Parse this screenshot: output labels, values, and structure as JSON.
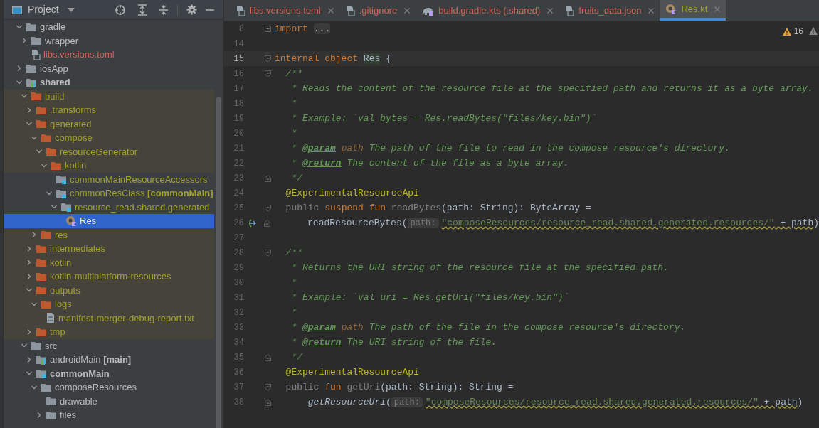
{
  "project_panel": {
    "title": "Project",
    "tree": [
      {
        "label": "gradle",
        "kind": "folder",
        "untracked": false,
        "excluded": false,
        "generated": false,
        "selected": false,
        "expanded": true,
        "children": [
          {
            "label": "wrapper",
            "kind": "folder",
            "untracked": false,
            "excluded": false,
            "generated": false,
            "selected": false,
            "expanded": false
          },
          {
            "label": "libs.versions.toml",
            "kind": "toml",
            "untracked": true,
            "excluded": false,
            "generated": false,
            "selected": false
          }
        ]
      },
      {
        "label": "iosApp",
        "kind": "folder",
        "untracked": false,
        "excluded": false,
        "generated": false,
        "selected": false,
        "expanded": false
      },
      {
        "label": "shared",
        "kind": "module",
        "untracked": false,
        "excluded": false,
        "generated": false,
        "selected": false,
        "bold": true,
        "expanded": true,
        "children": [
          {
            "label": "build",
            "kind": "folder",
            "untracked": false,
            "excluded": true,
            "generated": true,
            "selected": false,
            "expanded": true,
            "children": [
              {
                "label": ".transforms",
                "kind": "folder",
                "untracked": false,
                "excluded": true,
                "generated": true,
                "selected": false,
                "expanded": false
              },
              {
                "label": "generated",
                "kind": "folder",
                "untracked": false,
                "excluded": true,
                "generated": true,
                "selected": false,
                "expanded": true,
                "children": [
                  {
                    "label": "compose",
                    "kind": "folder",
                    "untracked": false,
                    "excluded": true,
                    "generated": true,
                    "selected": false,
                    "expanded": true,
                    "children": [
                      {
                        "label": "resourceGenerator",
                        "kind": "folder",
                        "untracked": false,
                        "excluded": true,
                        "generated": true,
                        "selected": false,
                        "expanded": true,
                        "children": [
                          {
                            "label": "kotlin",
                            "kind": "folder",
                            "untracked": false,
                            "excluded": true,
                            "generated": true,
                            "selected": false,
                            "expanded": true,
                            "children": [
                              {
                                "label": "commonMainResourceAccessors",
                                "kind": "source-folder",
                                "untracked": false,
                                "excluded": false,
                                "generated": true,
                                "selected": false
                              },
                              {
                                "label": "commonResClass **[commonMain]**",
                                "kind": "source-folder",
                                "untracked": false,
                                "excluded": false,
                                "generated": true,
                                "selected": false,
                                "expanded": true,
                                "children": [
                                  {
                                    "label": "resource_read.shared.generated",
                                    "kind": "package",
                                    "untracked": false,
                                    "excluded": false,
                                    "generated": true,
                                    "selected": false,
                                    "expanded": true,
                                    "children": [
                                      {
                                        "label": "Res",
                                        "kind": "kotlin-object",
                                        "untracked": false,
                                        "excluded": false,
                                        "generated": true,
                                        "selected": true
                                      }
                                    ]
                                  }
                                ]
                              }
                            ]
                          }
                        ]
                      }
                    ]
                  },
                  {
                    "label": "res",
                    "kind": "folder",
                    "untracked": false,
                    "excluded": true,
                    "generated": true,
                    "selected": false,
                    "expanded": false
                  }
                ]
              },
              {
                "label": "intermediates",
                "kind": "folder",
                "untracked": false,
                "excluded": true,
                "generated": true,
                "selected": false,
                "expanded": false
              },
              {
                "label": "kotlin",
                "kind": "folder",
                "untracked": false,
                "excluded": true,
                "generated": true,
                "selected": false,
                "expanded": false
              },
              {
                "label": "kotlin-multiplatform-resources",
                "kind": "folder",
                "untracked": false,
                "excluded": true,
                "generated": true,
                "selected": false,
                "expanded": false
              },
              {
                "label": "outputs",
                "kind": "folder",
                "untracked": false,
                "excluded": true,
                "generated": true,
                "selected": false,
                "expanded": true,
                "children": [
                  {
                    "label": "logs",
                    "kind": "folder",
                    "untracked": false,
                    "excluded": true,
                    "generated": true,
                    "selected": false,
                    "expanded": true,
                    "children": [
                      {
                        "label": "manifest-merger-debug-report.txt",
                        "kind": "text-file",
                        "untracked": false,
                        "excluded": true,
                        "generated": true,
                        "selected": false
                      }
                    ]
                  }
                ]
              },
              {
                "label": "tmp",
                "kind": "folder",
                "untracked": false,
                "excluded": true,
                "generated": true,
                "selected": false,
                "expanded": false
              }
            ]
          },
          {
            "label": "src",
            "kind": "folder",
            "untracked": false,
            "excluded": false,
            "generated": false,
            "selected": false,
            "expanded": true,
            "children": [
              {
                "label": "androidMain **[main]**",
                "kind": "module",
                "untracked": false,
                "excluded": false,
                "generated": false,
                "selected": false,
                "expanded": false
              },
              {
                "label": "commonMain",
                "kind": "source-folder",
                "untracked": false,
                "excluded": false,
                "generated": false,
                "selected": false,
                "bold": true,
                "expanded": true,
                "children": [
                  {
                    "label": "composeResources",
                    "kind": "folder",
                    "untracked": false,
                    "excluded": false,
                    "generated": false,
                    "selected": false,
                    "expanded": true,
                    "children": [
                      {
                        "label": "drawable",
                        "kind": "folder",
                        "untracked": false,
                        "excluded": false,
                        "generated": false,
                        "selected": false
                      },
                      {
                        "label": "files",
                        "kind": "folder",
                        "untracked": false,
                        "excluded": false,
                        "generated": false,
                        "selected": false,
                        "expanded": false
                      }
                    ]
                  }
                ]
              }
            ]
          }
        ]
      }
    ]
  },
  "editor": {
    "tabs": [
      {
        "label": "libs.versions.toml",
        "kind": "toml",
        "untracked": true,
        "generated": false,
        "selected": false
      },
      {
        "label": ".gitignore",
        "kind": "ignore",
        "untracked": true,
        "generated": false,
        "selected": false
      },
      {
        "label": "build.gradle.kts (:shared)",
        "kind": "gradle",
        "untracked": true,
        "generated": false,
        "selected": false
      },
      {
        "label": "fruits_data.json",
        "kind": "json",
        "untracked": true,
        "generated": false,
        "selected": false
      },
      {
        "label": "Res.kt",
        "kind": "kotlin-object",
        "untracked": false,
        "generated": true,
        "selected": true
      }
    ],
    "warning_count": "16",
    "lines": [
      {
        "number": "8",
        "kind": "collapsed",
        "current": false,
        "tokens": [
          {
            "kind": "keyword",
            "text": "import"
          },
          {
            "kind": "folded",
            "text": "..."
          }
        ]
      },
      {
        "number": "14",
        "kind": "plain",
        "current": false
      },
      {
        "number": "15",
        "kind": "fold-start",
        "current": true,
        "tokens": [
          {
            "kind": "keyword",
            "text": "internal object "
          },
          {
            "kind": "usage",
            "text": "Res"
          },
          {
            "kind": "plain",
            "text": " {"
          }
        ]
      },
      {
        "number": "16",
        "kind": "fold-start",
        "current": false,
        "tokens": [
          {
            "kind": "doc",
            "text": "  /**"
          }
        ]
      },
      {
        "number": "17",
        "kind": "plain",
        "current": false,
        "tokens": [
          {
            "kind": "doc",
            "text": "   * Reads the content of the resource file at the specified path and returns it as a byte array."
          }
        ]
      },
      {
        "number": "18",
        "kind": "plain",
        "current": false,
        "tokens": [
          {
            "kind": "doc",
            "text": "   *"
          }
        ]
      },
      {
        "number": "19",
        "kind": "plain",
        "current": false,
        "tokens": [
          {
            "kind": "doc",
            "text": "   * Example: `val bytes = Res.readBytes(\"files/key.bin\")`"
          }
        ]
      },
      {
        "number": "20",
        "kind": "plain",
        "current": false,
        "tokens": [
          {
            "kind": "doc",
            "text": "   *"
          }
        ]
      },
      {
        "number": "21",
        "kind": "plain",
        "current": false,
        "tokens": [
          {
            "kind": "doc",
            "text": "   * "
          },
          {
            "kind": "doctag",
            "text": "@param"
          },
          {
            "kind": "docparam",
            "text": " path"
          },
          {
            "kind": "doc",
            "text": " The path of the file to read in the compose resource's directory."
          }
        ]
      },
      {
        "number": "22",
        "kind": "plain",
        "current": false,
        "tokens": [
          {
            "kind": "doc",
            "text": "   * "
          },
          {
            "kind": "doctag",
            "text": "@return"
          },
          {
            "kind": "doc",
            "text": " The content of the file as a byte array."
          }
        ]
      },
      {
        "number": "23",
        "kind": "fold-end",
        "current": false,
        "tokens": [
          {
            "kind": "doc",
            "text": "   */"
          }
        ]
      },
      {
        "number": "24",
        "kind": "plain",
        "current": false,
        "tokens": [
          {
            "kind": "annotation",
            "text": "  @ExperimentalResourceApi"
          }
        ]
      },
      {
        "number": "25",
        "kind": "fold-start",
        "current": false,
        "tokens": [
          {
            "kind": "unused",
            "text": "  public"
          },
          {
            "kind": "keyword",
            "text": " suspend fun "
          },
          {
            "kind": "unused",
            "text": "readBytes"
          },
          {
            "kind": "plain",
            "text": "(path: String): ByteArray ="
          }
        ]
      },
      {
        "number": "26",
        "kind": "fold-end",
        "current": false,
        "mark": true,
        "tokens": [
          {
            "kind": "plain",
            "text": "      readResourceBytes("
          },
          {
            "kind": "hint",
            "text": "path:"
          },
          {
            "kind": "warn-string",
            "text": "\"composeResources/resource_read.shared.generated.resources/\""
          },
          {
            "kind": "warn-plain",
            "text": " + path"
          },
          {
            "kind": "plain",
            "text": ")"
          }
        ]
      },
      {
        "number": "27",
        "kind": "plain",
        "current": false
      },
      {
        "number": "28",
        "kind": "fold-start",
        "current": false,
        "tokens": [
          {
            "kind": "doc",
            "text": "  /**"
          }
        ]
      },
      {
        "number": "29",
        "kind": "plain",
        "current": false,
        "tokens": [
          {
            "kind": "doc",
            "text": "   * Returns the URI string of the resource file at the specified path."
          }
        ]
      },
      {
        "number": "30",
        "kind": "plain",
        "current": false,
        "tokens": [
          {
            "kind": "doc",
            "text": "   *"
          }
        ]
      },
      {
        "number": "31",
        "kind": "plain",
        "current": false,
        "tokens": [
          {
            "kind": "doc",
            "text": "   * Example: `val uri = Res.getUri(\"files/key.bin\")`"
          }
        ]
      },
      {
        "number": "32",
        "kind": "plain",
        "current": false,
        "tokens": [
          {
            "kind": "doc",
            "text": "   *"
          }
        ]
      },
      {
        "number": "33",
        "kind": "plain",
        "current": false,
        "tokens": [
          {
            "kind": "doc",
            "text": "   * "
          },
          {
            "kind": "doctag",
            "text": "@param"
          },
          {
            "kind": "docparam",
            "text": " path"
          },
          {
            "kind": "doc",
            "text": " The path of the file in the compose resource's directory."
          }
        ]
      },
      {
        "number": "34",
        "kind": "plain",
        "current": false,
        "tokens": [
          {
            "kind": "doc",
            "text": "   * "
          },
          {
            "kind": "doctag",
            "text": "@return"
          },
          {
            "kind": "doc",
            "text": " The URI string of the file."
          }
        ]
      },
      {
        "number": "35",
        "kind": "fold-end",
        "current": false,
        "tokens": [
          {
            "kind": "doc",
            "text": "   */"
          }
        ]
      },
      {
        "number": "36",
        "kind": "plain",
        "current": false,
        "tokens": [
          {
            "kind": "annotation",
            "text": "  @ExperimentalResourceApi"
          }
        ]
      },
      {
        "number": "37",
        "kind": "fold-start",
        "current": false,
        "tokens": [
          {
            "kind": "unused",
            "text": "  public"
          },
          {
            "kind": "keyword",
            "text": " fun "
          },
          {
            "kind": "unused",
            "text": "getUri"
          },
          {
            "kind": "plain",
            "text": "(path: String): String ="
          }
        ]
      },
      {
        "number": "38",
        "kind": "fold-end",
        "current": false,
        "tokens": [
          {
            "kind": "static-call",
            "text": "      getResourceUri"
          },
          {
            "kind": "plain",
            "text": "("
          },
          {
            "kind": "hint",
            "text": "path:"
          },
          {
            "kind": "warn-string",
            "text": "\"composeResources/resource_read.shared.generated.resources/\""
          },
          {
            "kind": "warn-plain",
            "text": " + path"
          },
          {
            "kind": "plain",
            "text": ")"
          }
        ]
      }
    ]
  }
}
